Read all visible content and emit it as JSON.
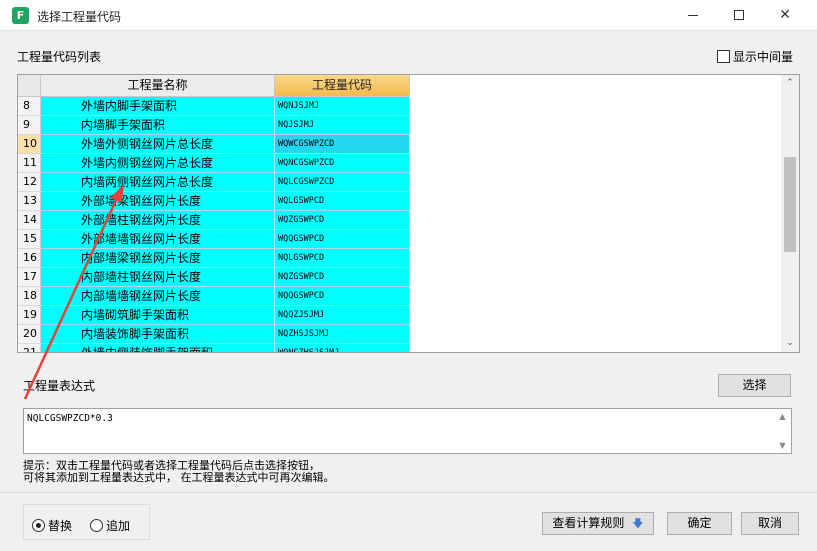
{
  "window": {
    "title": "选择工程量代码",
    "app_icon_glyph": "F",
    "close_glyph": "✕"
  },
  "list_label": "工程量代码列表",
  "show_intermediate": {
    "label": "显示中间量",
    "checked": false
  },
  "grid": {
    "headers": {
      "name": "工程量名称",
      "code": "工程量代码"
    },
    "rows": [
      {
        "num": "8",
        "name": "外墙内脚手架面积",
        "code": "WQNJSJMJ"
      },
      {
        "num": "9",
        "name": "内墙脚手架面积",
        "code": "NQJSJMJ"
      },
      {
        "num": "10",
        "name": "外墙外侧钢丝网片总长度",
        "code": "WQWCGSWPZCD"
      },
      {
        "num": "11",
        "name": "外墙内侧钢丝网片总长度",
        "code": "WQNCGSWPZCD"
      },
      {
        "num": "12",
        "name": "内墙两侧钢丝网片总长度",
        "code": "NQLCGSWPZCD"
      },
      {
        "num": "13",
        "name": "外部墙梁钢丝网片长度",
        "code": "WQLGSWPCD"
      },
      {
        "num": "14",
        "name": "外部墙柱钢丝网片长度",
        "code": "WQZGSWPCD"
      },
      {
        "num": "15",
        "name": "外部墙墙钢丝网片长度",
        "code": "WQQGSWPCD"
      },
      {
        "num": "16",
        "name": "内部墙梁钢丝网片长度",
        "code": "NQLGSWPCD"
      },
      {
        "num": "17",
        "name": "内部墙柱钢丝网片长度",
        "code": "NQZGSWPCD"
      },
      {
        "num": "18",
        "name": "内部墙墙钢丝网片长度",
        "code": "NQQGSWPCD"
      },
      {
        "num": "19",
        "name": "内墙砌筑脚手架面积",
        "code": "NQQZJSJMJ"
      },
      {
        "num": "20",
        "name": "内墙装饰脚手架面积",
        "code": "NQZHSJSJMJ"
      },
      {
        "num": "21",
        "name": "外墙内侧装饰脚手架面积",
        "code": "WQNCZHSJSJMJ"
      }
    ],
    "selected_row": 2
  },
  "expression": {
    "label": "工程量表达式",
    "value": "NQLCGSWPZCD*0.3",
    "select_button": "选择"
  },
  "hint": {
    "line1": "提示：双击工程量代码或者选择工程量代码后点击选择按钮，",
    "line2": "可将其添加到工程量表达式中， 在工程量表达式中可再次编辑。"
  },
  "mode": {
    "replace": "替换",
    "append": "追加",
    "selected": "replace"
  },
  "buttons": {
    "view_rules": "查看计算规则",
    "ok": "确定",
    "cancel": "取消"
  },
  "colors": {
    "cell_bg": "#00ffff",
    "code_header": "#f5b94b",
    "annotation_arrow": "#e8413a"
  },
  "icons": [
    "app-icon",
    "minimize-icon",
    "maximize-icon",
    "close-icon",
    "arrow-down-icon",
    "scroll-up-icon",
    "scroll-down-icon"
  ]
}
